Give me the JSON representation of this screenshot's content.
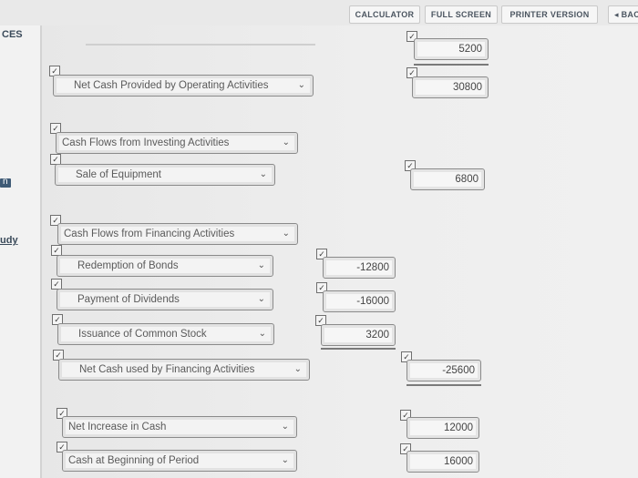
{
  "toolbar": {
    "calculator": "CALCULATOR",
    "full_screen": "FULL SCREEN",
    "printer_version": "PRINTER VERSION",
    "back": "◂ BAC"
  },
  "sidebar": {
    "top_label": "CES",
    "icon_label": "n",
    "study_label": "udy"
  },
  "statement": {
    "first_amount": "5200",
    "operating_total_label": "Net Cash Provided by Operating Activities",
    "operating_total_value": "30800",
    "investing_header": "Cash Flows from Investing Activities",
    "sale_of_equipment_label": "Sale of Equipment",
    "sale_of_equipment_value": "6800",
    "financing_header": "Cash Flows from Financing Activities",
    "redemption_label": "Redemption of Bonds",
    "redemption_value": "-12800",
    "dividends_label": "Payment of Dividends",
    "dividends_value": "-16000",
    "stock_label": "Issuance of Common Stock",
    "stock_value": "3200",
    "financing_total_label": "Net Cash used by Financing Activities",
    "financing_total_value": "-25600",
    "net_increase_label": "Net Increase in Cash",
    "net_increase_value": "12000",
    "beginning_label": "Cash at Beginning of Period",
    "beginning_value": "16000"
  },
  "checkmark": "✓"
}
